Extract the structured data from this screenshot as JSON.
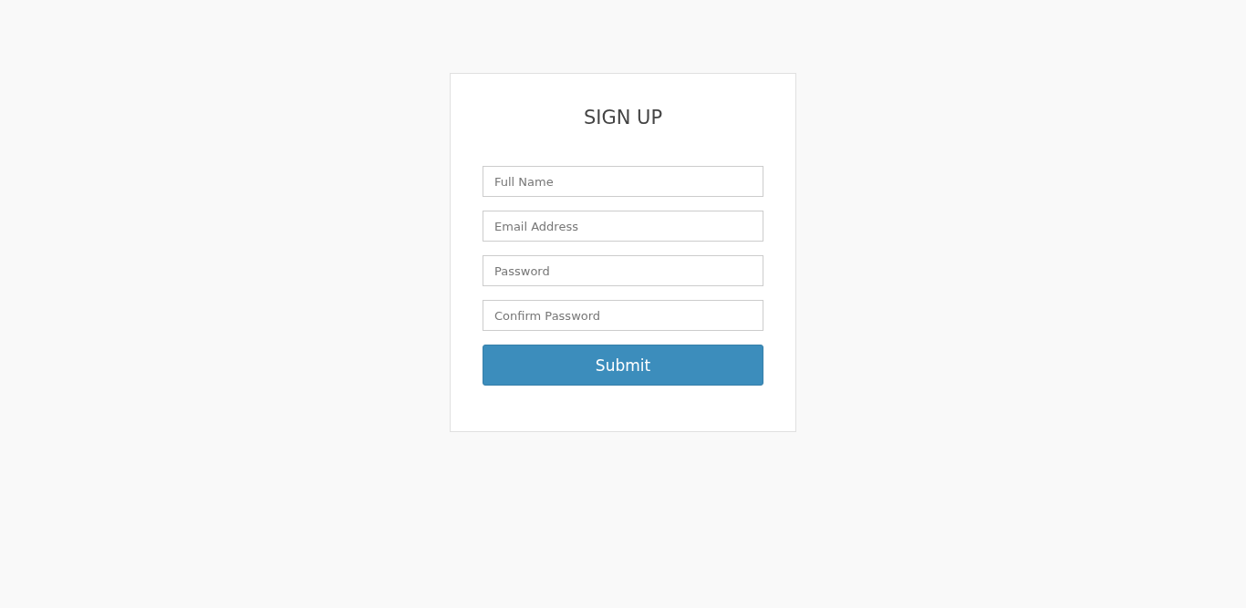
{
  "form": {
    "title": "SIGN UP",
    "fields": [
      {
        "placeholder": "Full Name"
      },
      {
        "placeholder": "Email Address"
      },
      {
        "placeholder": "Password"
      },
      {
        "placeholder": "Confirm Password"
      }
    ],
    "submit": "Submit"
  }
}
